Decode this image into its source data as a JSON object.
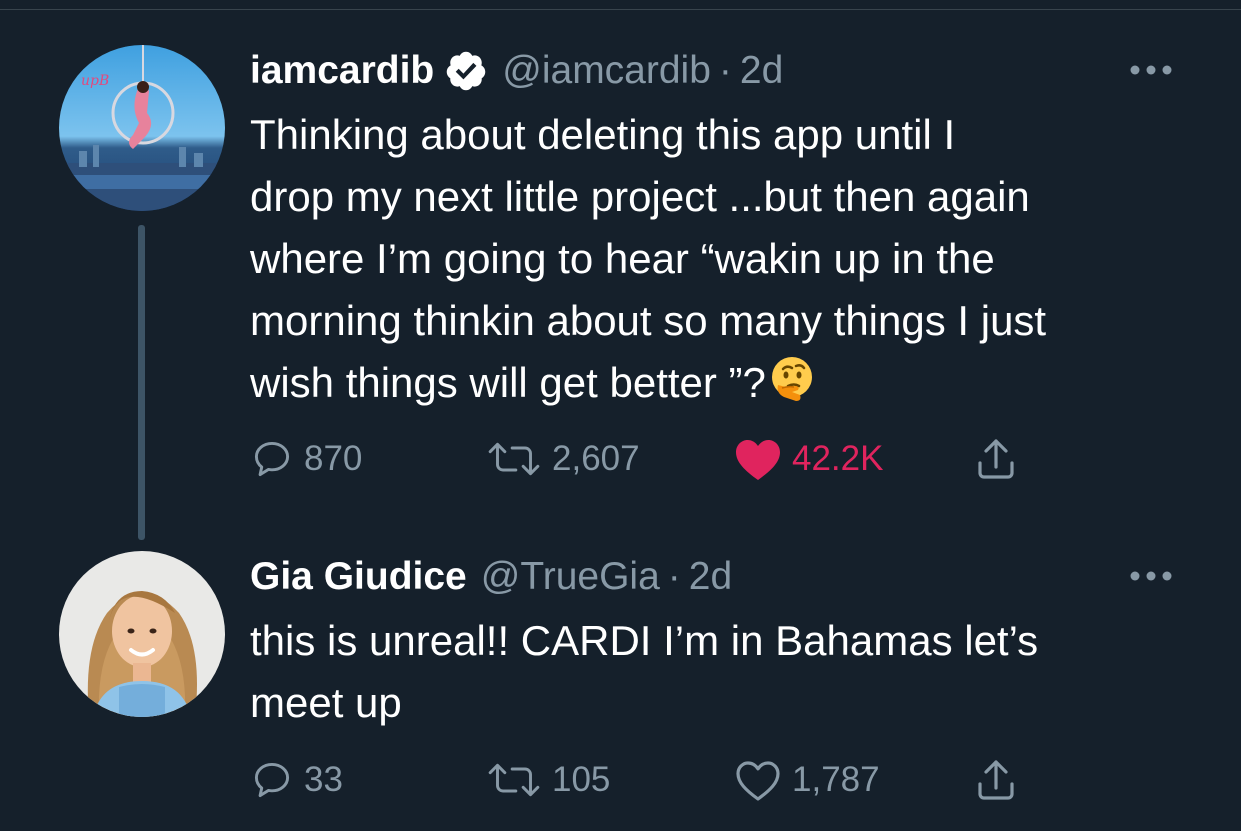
{
  "tweets": [
    {
      "display_name": "iamcardib",
      "verified": true,
      "handle": "@iamcardib",
      "separator": "·",
      "time": "2d",
      "text_lines": [
        "Thinking about deleting this app until I",
        "drop my next little project ...but then again",
        "where I’m going to hear “wakin up in the",
        "morning thinkin about so many things I just",
        "wish things will get better ”?"
      ],
      "emoji": "thinking-face",
      "replies": "870",
      "retweets": "2,607",
      "likes": "42.2K",
      "liked": true,
      "like_color": "#e0245e"
    },
    {
      "display_name": "Gia Giudice",
      "verified": false,
      "handle": "@TrueGia",
      "separator": "·",
      "time": "2d",
      "text_lines": [
        "this is unreal!! CARDI I’m in Bahamas let’s",
        "meet up"
      ],
      "replies": "33",
      "retweets": "105",
      "likes": "1,787",
      "liked": false
    }
  ],
  "colors": {
    "background": "#15202b",
    "secondary_text": "#8899a6",
    "thread_line": "#3d5466",
    "like": "#e0245e"
  }
}
